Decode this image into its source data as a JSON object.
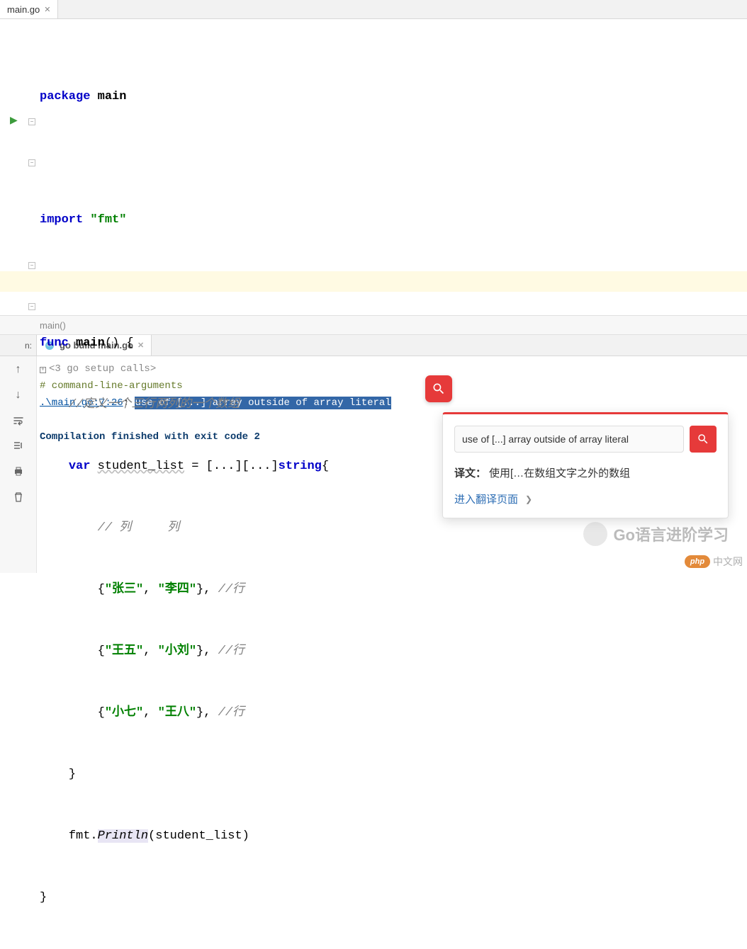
{
  "tab": {
    "filename": "main.go"
  },
  "code": {
    "l1": {
      "kw1": "package",
      "pkg": "main"
    },
    "l3": {
      "kw1": "import",
      "str": "\"fmt\""
    },
    "l5": {
      "kw1": "func",
      "fn": "main",
      "rest": "() {"
    },
    "l6": {
      "cm": "//定义一个三行两列的一个数组"
    },
    "l7": {
      "kw1": "var",
      "id": "student_list",
      "eq": " = [...][...]",
      "kw2": "string",
      "br": "{"
    },
    "l8": {
      "cm": "// 列     列"
    },
    "l9": {
      "br1": "{",
      "s1": "\"张三\"",
      "c": ", ",
      "s2": "\"李四\"",
      "br2": "}, ",
      "cm": "//行"
    },
    "l10": {
      "br1": "{",
      "s1": "\"王五\"",
      "c": ", ",
      "s2": "\"小刘\"",
      "br2": "}, ",
      "cm": "//行"
    },
    "l11": {
      "br1": "{",
      "s1": "\"小七\"",
      "c": ", ",
      "s2": "\"王八\"",
      "br2": "}, ",
      "cm": "//行"
    },
    "l12": {
      "br": "}"
    },
    "l13": {
      "pkg": "fmt",
      "dot": ".",
      "fn": "Println",
      "arg": "(student_list)"
    },
    "l14": {
      "br": "}"
    }
  },
  "breadcrumb": "main()",
  "build_header": {
    "label_left": "n:",
    "tab": "go build main.go"
  },
  "output": {
    "setup": "<3 go setup calls>",
    "cmd": "# command-line-arguments",
    "err_loc": ".\\main.go:7:26",
    "err_sep": ": ",
    "err_msg": "use of [...] array outside of array literal",
    "done": "Compilation finished with exit code 2"
  },
  "popup": {
    "input": "use of [...] array outside of array literal",
    "trans_label": "译文：",
    "trans_text": "使用[…在数组文字之外的数组",
    "link": "进入翻译页面"
  },
  "watermark1": "Go语言进阶学习",
  "watermark2_badge": "php",
  "watermark2_text": "中文网"
}
